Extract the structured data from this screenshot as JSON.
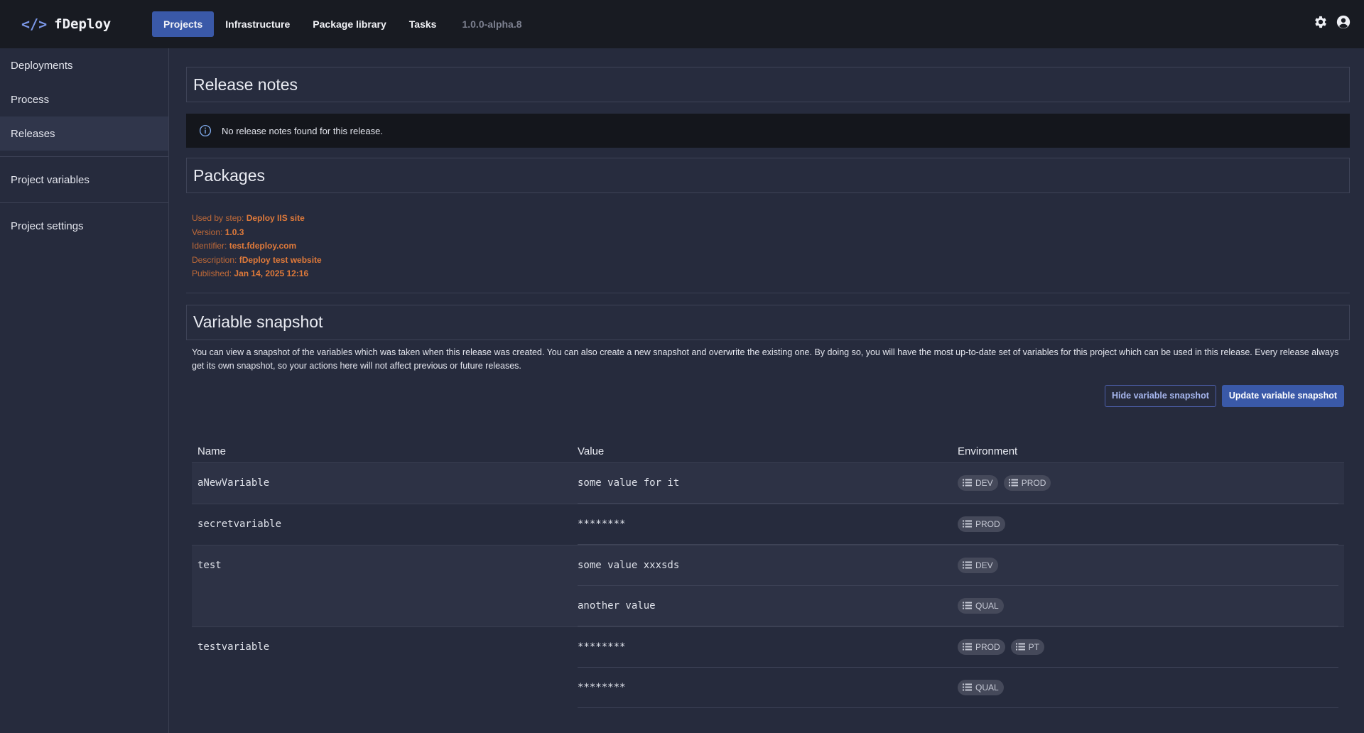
{
  "app": {
    "logo_icon": "</>",
    "logo_text": "fDeploy",
    "version": "1.0.0-alpha.8"
  },
  "nav": {
    "items": [
      {
        "label": "Projects",
        "active": true
      },
      {
        "label": "Infrastructure",
        "active": false
      },
      {
        "label": "Package library",
        "active": false
      },
      {
        "label": "Tasks",
        "active": false
      }
    ]
  },
  "header_icons": [
    "gear-icon",
    "user-circle-icon"
  ],
  "sidebar": {
    "items": [
      {
        "label": "Deployments"
      },
      {
        "label": "Process"
      },
      {
        "label": "Releases",
        "active": true
      },
      {
        "label": "Project variables"
      },
      {
        "label": "Project settings"
      }
    ]
  },
  "release_notes": {
    "title": "Release notes",
    "notice": "No release notes found for this release."
  },
  "packages": {
    "title": "Packages",
    "used_by_label": "Used by step:",
    "used_by": "Deploy IIS site",
    "version_label": "Version:",
    "version": "1.0.3",
    "identifier_label": "Identifier:",
    "identifier": "test.fdeploy.com",
    "description_label": "Description:",
    "description": "fDeploy test website",
    "published_label": "Published:",
    "published": "Jan 14, 2025 12:16"
  },
  "snapshot": {
    "title": "Variable snapshot",
    "description": "You can view a snapshot of the variables which was taken when this release was created. You can also create a new snapshot and overwrite the existing one. By doing so, you will have the most up-to-date set of variables for this project which can be used in this release. Every release always get its own snapshot, so your actions here will not affect previous or future releases.",
    "hide_button": "Hide variable snapshot",
    "update_button": "Update variable snapshot",
    "columns": {
      "name": "Name",
      "value": "Value",
      "environment": "Environment"
    },
    "variables": [
      {
        "name": "aNewVariable",
        "values": [
          {
            "value": "some value for it",
            "envs": [
              "DEV",
              "PROD"
            ]
          }
        ]
      },
      {
        "name": "secretvariable",
        "values": [
          {
            "value": "********",
            "envs": [
              "PROD"
            ]
          }
        ]
      },
      {
        "name": "test",
        "values": [
          {
            "value": "some value xxxsds",
            "envs": [
              "DEV"
            ]
          },
          {
            "value": "another value",
            "envs": [
              "QUAL"
            ]
          }
        ]
      },
      {
        "name": "testvariable",
        "values": [
          {
            "value": "********",
            "envs": [
              "PROD",
              "PT"
            ]
          },
          {
            "value": "********",
            "envs": [
              "QUAL"
            ]
          }
        ]
      }
    ]
  },
  "colors": {
    "accent": "#3a59a8",
    "package_text": "#e07a3a",
    "background": "#262b3d",
    "topbar": "#181b22"
  }
}
